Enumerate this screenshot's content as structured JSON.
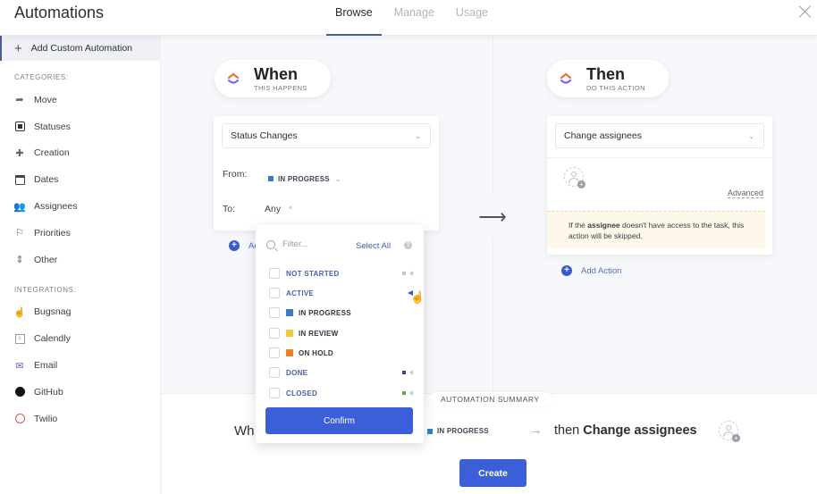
{
  "header": {
    "title": "Automations",
    "tabs": [
      {
        "label": "Browse",
        "active": true
      },
      {
        "label": "Manage",
        "active": false
      },
      {
        "label": "Usage",
        "active": false
      }
    ],
    "close_icon": "close-icon"
  },
  "sidebar": {
    "add_custom": "Add Custom Automation",
    "categories_heading": "CATEGORIES:",
    "categories": [
      {
        "label": "Move",
        "icon": "move-arrow-icon"
      },
      {
        "label": "Statuses",
        "icon": "status-square-icon"
      },
      {
        "label": "Creation",
        "icon": "creation-plus-icon"
      },
      {
        "label": "Dates",
        "icon": "calendar-icon"
      },
      {
        "label": "Assignees",
        "icon": "people-icon"
      },
      {
        "label": "Priorities",
        "icon": "flag-icon"
      },
      {
        "label": "Other",
        "icon": "other-icon"
      }
    ],
    "integrations_heading": "INTEGRATIONS:",
    "integrations": [
      {
        "label": "Bugsnag",
        "icon": "bugsnag-icon"
      },
      {
        "label": "Calendly",
        "icon": "calendly-icon"
      },
      {
        "label": "Email",
        "icon": "email-icon"
      },
      {
        "label": "GitHub",
        "icon": "github-icon"
      },
      {
        "label": "Twilio",
        "icon": "twilio-icon"
      }
    ]
  },
  "when": {
    "title": "When",
    "subtitle": "THIS HAPPENS",
    "trigger": "Status Changes",
    "from_label": "From:",
    "from_value": "IN PROGRESS",
    "to_label": "To:",
    "to_value": "Any",
    "add_label": "Add"
  },
  "then": {
    "title": "Then",
    "subtitle": "DO THIS ACTION",
    "action": "Change assignees",
    "advanced": "Advanced",
    "warning_pre": "If the ",
    "warning_bold": "assignee",
    "warning_post": " doesn't have access to the task, this action will be skipped.",
    "add_action": "Add Action"
  },
  "dropdown": {
    "filter_placeholder": "Filter...",
    "select_all": "Select All",
    "help": "?",
    "statuses": [
      {
        "label": "NOT STARTED",
        "color": null,
        "tail_color": "#c4c6ca"
      },
      {
        "label": "ACTIVE",
        "color": null,
        "tail_color": "#3b5bc8"
      },
      {
        "label": "IN PROGRESS",
        "color": "#3a7bc8",
        "tail_color": null
      },
      {
        "label": "IN REVIEW",
        "color": "#f5c842",
        "tail_color": null
      },
      {
        "label": "ON HOLD",
        "color": "#f07f23",
        "tail_color": null
      },
      {
        "label": "DONE",
        "color": null,
        "tail_color": "#3b3fa8"
      },
      {
        "label": "CLOSED",
        "color": null,
        "tail_color": "#6fa35a"
      }
    ],
    "confirm": "Confirm"
  },
  "summary": {
    "label": "AUTOMATION SUMMARY",
    "when_text": "Wh",
    "status": "IN PROGRESS",
    "then_text": "then",
    "action": "Change assignees"
  },
  "create": "Create"
}
